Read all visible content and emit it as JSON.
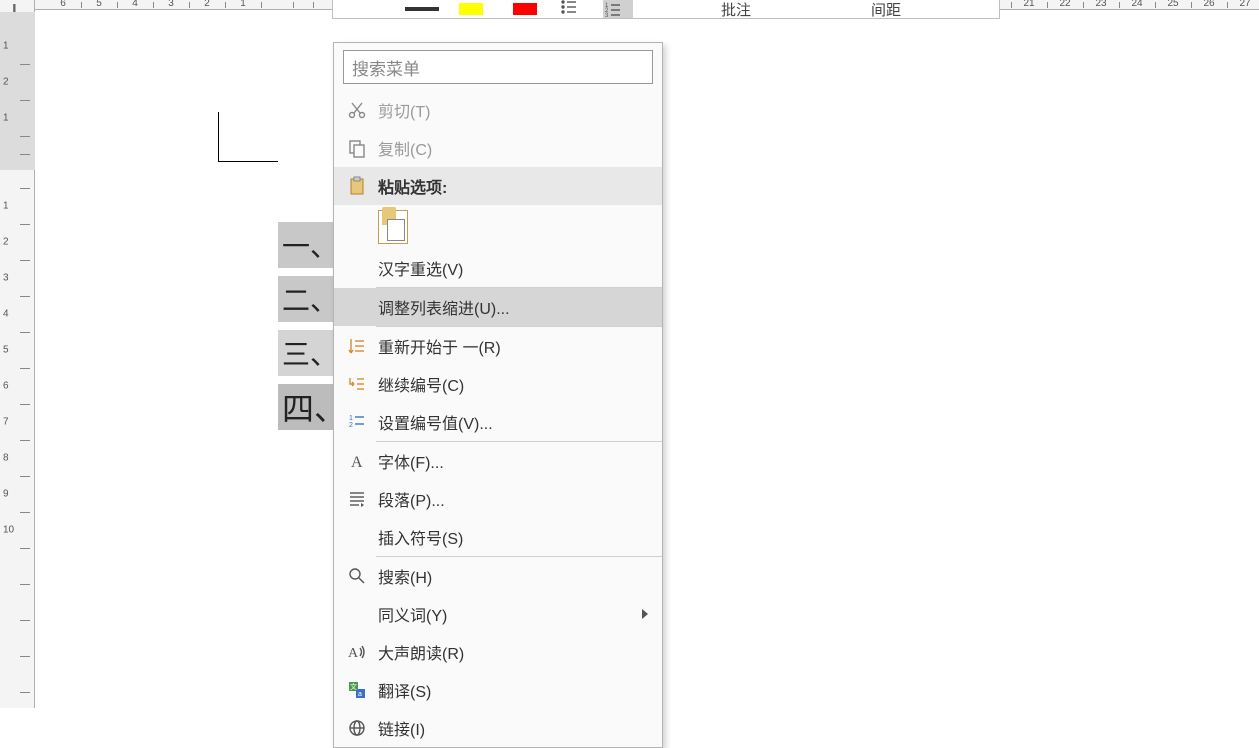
{
  "ruler_corner": "L",
  "top_ruler_left": [
    "6",
    "5",
    "4",
    "3",
    "2",
    "1"
  ],
  "top_ruler_right": [
    "21",
    "22",
    "23",
    "24",
    "25",
    "26",
    "27"
  ],
  "left_ruler": [
    "1",
    "2",
    "1",
    "1",
    "2",
    "3",
    "4",
    "5",
    "6",
    "7",
    "8",
    "9",
    "10"
  ],
  "mini_toolbar": {
    "comment_label": "批注",
    "spacing_label": "间距"
  },
  "doc_list": [
    "一、",
    "二、",
    "三、",
    "四、"
  ],
  "context_menu": {
    "search_placeholder": "搜索菜单",
    "cut": "剪切(T)",
    "copy": "复制(C)",
    "paste_header": "粘贴选项:",
    "hanzi": "汉字重选(V)",
    "adjust_indent": "调整列表缩进(U)...",
    "restart": "重新开始于 一(R)",
    "continue": "继续编号(C)",
    "set_value": "设置编号值(V)...",
    "font": "字体(F)...",
    "paragraph": "段落(P)...",
    "symbol": "插入符号(S)",
    "search": "搜索(H)",
    "synonym": "同义词(Y)",
    "read_aloud": "大声朗读(R)",
    "translate": "翻译(S)",
    "link": "链接(I)"
  }
}
